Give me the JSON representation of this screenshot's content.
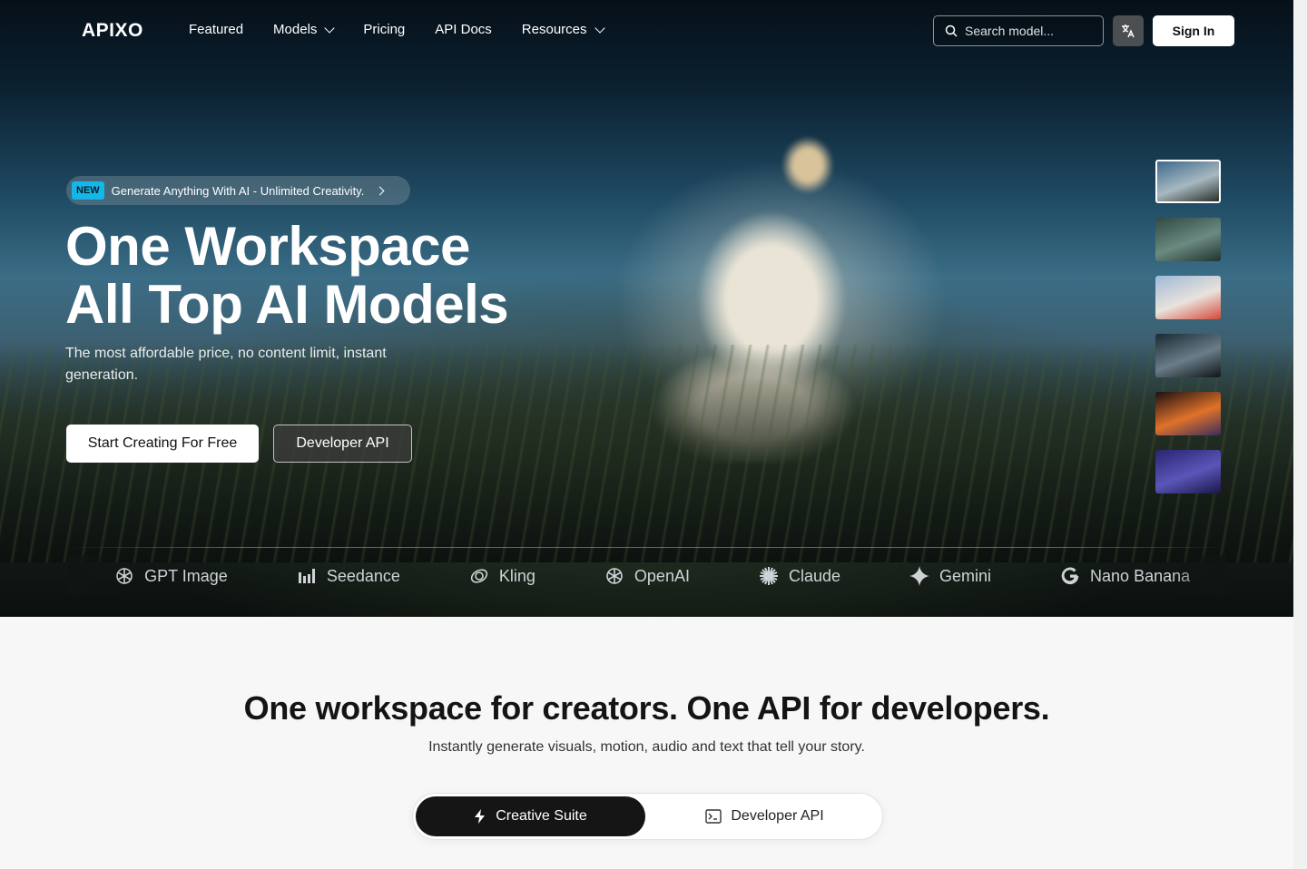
{
  "header": {
    "logo": "APIXO",
    "nav": [
      {
        "label": "Featured",
        "dropdown": false
      },
      {
        "label": "Models",
        "dropdown": true
      },
      {
        "label": "Pricing",
        "dropdown": false
      },
      {
        "label": "API Docs",
        "dropdown": false
      },
      {
        "label": "Resources",
        "dropdown": true
      }
    ],
    "search_placeholder": "Search model...",
    "language_icon": "translate-icon",
    "sign_in": "Sign In"
  },
  "hero": {
    "badge_tag": "NEW",
    "badge_text": "Generate Anything With AI - Unlimited Creativity.",
    "title_line1": "One Workspace",
    "title_line2": "All Top AI Models",
    "subtitle": "The most affordable price, no content limit, instant generation.",
    "primary_cta": "Start Creating For Free",
    "secondary_cta": "Developer API",
    "thumbnails": [
      {
        "name": "runner-thumbnail",
        "active": true,
        "colors": [
          "#3d6a8d",
          "#a7b8c0",
          "#2a2f2a"
        ]
      },
      {
        "name": "forest-thumbnail",
        "active": false,
        "colors": [
          "#2f4a44",
          "#6b8a80",
          "#1f3330"
        ]
      },
      {
        "name": "flower-thumbnail",
        "active": false,
        "colors": [
          "#9fb9d6",
          "#e9e2dc",
          "#d34a3a"
        ]
      },
      {
        "name": "helmet-thumbnail",
        "active": false,
        "colors": [
          "#1a2a33",
          "#6a7d88",
          "#0f1418"
        ]
      },
      {
        "name": "fire-thumbnail",
        "active": false,
        "colors": [
          "#1a1010",
          "#e0722a",
          "#3a2d5a"
        ]
      },
      {
        "name": "dancer-thumbnail",
        "active": false,
        "colors": [
          "#2a2470",
          "#5a56b8",
          "#1a1648"
        ]
      }
    ]
  },
  "models": [
    {
      "label": "Nano Banana",
      "icon": "google-icon"
    },
    {
      "label": "GPT Image",
      "icon": "openai-icon"
    },
    {
      "label": "Seedance",
      "icon": "bars-icon"
    },
    {
      "label": "Kling",
      "icon": "kling-icon"
    },
    {
      "label": "OpenAI",
      "icon": "openai-icon"
    },
    {
      "label": "Claude",
      "icon": "claude-icon"
    },
    {
      "label": "Gemini",
      "icon": "gemini-icon"
    },
    {
      "label": "Nano Banana",
      "icon": "google-icon"
    }
  ],
  "section": {
    "title": "One workspace for creators. One API for developers.",
    "subtitle": "Instantly generate visuals, motion, audio and text that tell your story.",
    "tabs": [
      {
        "label": "Creative Suite",
        "icon": "bolt-icon",
        "active": true
      },
      {
        "label": "Developer API",
        "icon": "terminal-icon",
        "active": false
      }
    ]
  }
}
